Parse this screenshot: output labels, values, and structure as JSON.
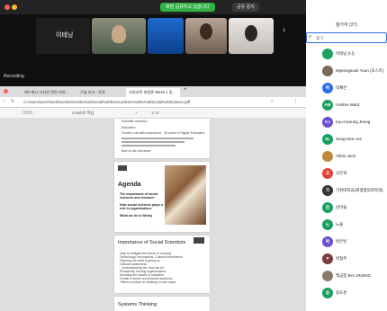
{
  "share_bar": {
    "sharing_label": "화면 공유하고 있습니다",
    "stop_label": "공유 중지"
  },
  "gallery": {
    "tile_name": "이테닝",
    "recording_label": "Recording",
    "next_arrow": "›"
  },
  "browser": {
    "tabs": [
      "에드위나 디자인 관련 자료...",
      "구술 보고 - 토론",
      "사회과학 방법론 Week 1 및..."
    ],
    "url": "C:/Users/user/OneDrive/Intro%20to%20Social%20Science/Intro%20to%20Social%20Science.pdf",
    "pdf_toolbar": [
      "그리기",
      "Crash의 학습"
    ],
    "page_count": "1 / 6",
    "zoom": "+",
    "page1": {
      "lines": [
        "Scientific research",
        "Education",
        "Chosen Lab with experience - 35 years in Higher Education",
        "",
        "Born in the Universe!"
      ]
    },
    "page2": {
      "title": "Agenda",
      "bullets": [
        "The importance of social sciences and research",
        "How social sciences plays a role in organisations",
        "What we do in Wintry"
      ]
    },
    "page3": {
      "title": "Importance of Social Scientists",
      "lines": [
        "Help to mitigate the future of humans",
        "Technology, Innovations, Cultural Information",
        "Figuring out what is going on",
        "Cultural awareness",
        "Understanding the 'how we do'",
        "Proactively moving organizations",
        "Avoiding the issues of outsiders",
        "Create a sense and focused solutions",
        "Offers a culture for thinking in new ways"
      ]
    },
    "page4": {
      "title": "Systems Thinking"
    }
  },
  "panel": {
    "title": "참가자 (27)",
    "search_placeholder": "찾기",
    "participants": [
      {
        "initials": "",
        "name": "이테닝 (나)",
        "color": "#1aa060"
      },
      {
        "initials": "",
        "name": "Myeongsook Yoon (호스트)",
        "color": "#7a6a5a"
      },
      {
        "initials": "박",
        "name": "박채은",
        "color": "#2d6fe8"
      },
      {
        "initials": "AW",
        "name": "Andrea Ward",
        "color": "#1aa060"
      },
      {
        "initials": "KJ",
        "name": "Kyu-Hyoung Jeong",
        "color": "#6b4fcf"
      },
      {
        "initials": "SL",
        "name": "Sung-Hee Lee",
        "color": "#1aa060"
      },
      {
        "initials": "",
        "name": "Yebin Jeon",
        "color": "#c08a3e"
      },
      {
        "initials": "고",
        "name": "고은희",
        "color": "#e0453a"
      },
      {
        "initials": "가",
        "name": "가천대학교(회생협의회학과)",
        "color": "#333"
      },
      {
        "initials": "김",
        "name": "김미솔",
        "color": "#1aa060"
      },
      {
        "initials": "노",
        "name": "노을",
        "color": "#1aa060"
      },
      {
        "initials": "박",
        "name": "박은빈",
        "color": "#6b4fcf"
      },
      {
        "initials": "P",
        "name": "박형주",
        "color": "#7a3b3b"
      },
      {
        "initials": "",
        "name": "백금정 BAI JINJING",
        "color": "#8a7a6a"
      },
      {
        "initials": "송",
        "name": "송도훈",
        "color": "#1aa060"
      }
    ]
  }
}
